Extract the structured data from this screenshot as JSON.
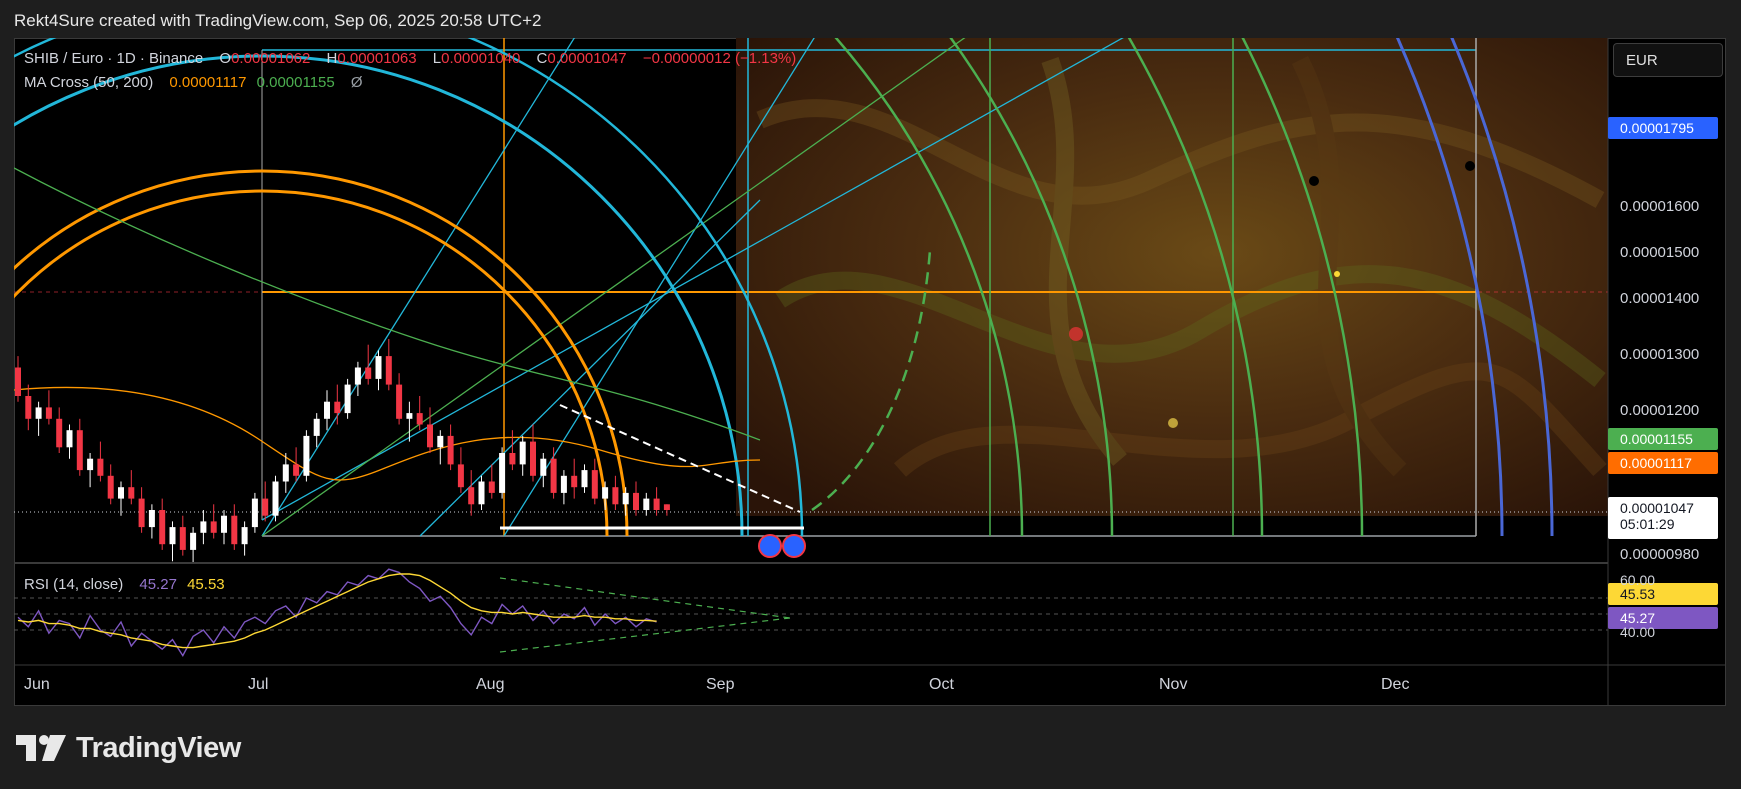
{
  "header": {
    "attribution": "Rekt4Sure created with TradingView.com, Sep 06, 2025 20:58 UTC+2"
  },
  "legend": {
    "symbol": "SHIB / Euro · 1D · Binance",
    "o_label": "O",
    "o_value": "0.00001062",
    "h_label": "H",
    "h_value": "0.00001063",
    "l_label": "L",
    "l_value": "0.00001040",
    "c_label": "C",
    "c_value": "0.00001047",
    "change": "−0.00000012 (−1.13%)",
    "ma_label": "MA Cross (50, 200)",
    "ma_fast": "0.00001117",
    "ma_slow": "0.00001155",
    "ma_extra": "Ø",
    "rsi_label": "RSI (14, close)",
    "rsi_value": "45.27",
    "rsi_ma": "45.53"
  },
  "currency_button": "EUR",
  "colors": {
    "up": "#ffffff",
    "down": "#f23645",
    "ma_fast": "#ff9800",
    "ma_slow": "#4caf50",
    "rsi": "#7e57c2",
    "rsi_ma": "#fdd835",
    "fib_cyan": "#22b7d9",
    "fib_green": "#4caf50",
    "fib_blue": "#4a67d6",
    "fib_orange": "#ff9800",
    "accent": "#2962ff"
  },
  "price_tags": {
    "top": "0.00001795",
    "ma_slow": "0.00001155",
    "ma_fast": "0.00001117",
    "last": "0.00001047",
    "countdown": "05:01:29",
    "rsi_ma": "45.53",
    "rsi": "45.27"
  },
  "logo": {
    "text": "TradingView"
  },
  "chart_data": [
    {
      "type": "candlestick",
      "title": "SHIB / Euro · 1D · Binance",
      "y_ticks": [
        "0.00001600",
        "0.00001500",
        "0.00001400",
        "0.00001300",
        "0.00001200",
        "0.00000980"
      ],
      "x_ticks": [
        "Jun",
        "Jul",
        "Aug",
        "Sep",
        "Oct",
        "Nov",
        "Dec"
      ],
      "last_close": 1.047e-05,
      "highlight_levels": [
        1.795e-05,
        1.155e-05,
        1.117e-05,
        1.047e-05,
        1.42e-05
      ],
      "ylim": [
        9.4e-06,
        1.85e-05
      ],
      "ohlc_approx": [
        [
          1.3e-05,
          1.32e-05,
          1.24e-05,
          1.25e-05
        ],
        [
          1.25e-05,
          1.27e-05,
          1.19e-05,
          1.21e-05
        ],
        [
          1.21e-05,
          1.24e-05,
          1.18e-05,
          1.23e-05
        ],
        [
          1.23e-05,
          1.26e-05,
          1.2e-05,
          1.21e-05
        ],
        [
          1.21e-05,
          1.23e-05,
          1.15e-05,
          1.16e-05
        ],
        [
          1.16e-05,
          1.2e-05,
          1.14e-05,
          1.19e-05
        ],
        [
          1.19e-05,
          1.21e-05,
          1.11e-05,
          1.12e-05
        ],
        [
          1.12e-05,
          1.15e-05,
          1.09e-05,
          1.14e-05
        ],
        [
          1.14e-05,
          1.17e-05,
          1.1e-05,
          1.11e-05
        ],
        [
          1.11e-05,
          1.13e-05,
          1.06e-05,
          1.07e-05
        ],
        [
          1.07e-05,
          1.1e-05,
          1.04e-05,
          1.09e-05
        ],
        [
          1.09e-05,
          1.12e-05,
          1.06e-05,
          1.07e-05
        ],
        [
          1.07e-05,
          1.09e-05,
          1.01e-05,
          1.02e-05
        ],
        [
          1.02e-05,
          1.06e-05,
          1e-05,
          1.05e-05
        ],
        [
          1.05e-05,
          1.07e-05,
          9.8e-06,
          9.9e-06
        ],
        [
          9.9e-06,
          1.03e-05,
          9.6e-06,
          1.02e-05
        ],
        [
          1.02e-05,
          1.04e-05,
          9.7e-06,
          9.8e-06
        ],
        [
          9.8e-06,
          1.02e-05,
          9.5e-06,
          1.01e-05
        ],
        [
          1.01e-05,
          1.05e-05,
          9.9e-06,
          1.03e-05
        ],
        [
          1.03e-05,
          1.06e-05,
          1e-05,
          1.01e-05
        ],
        [
          1.01e-05,
          1.05e-05,
          9.9e-06,
          1.04e-05
        ],
        [
          1.04e-05,
          1.06e-05,
          9.8e-06,
          9.9e-06
        ],
        [
          9.9e-06,
          1.03e-05,
          9.7e-06,
          1.02e-05
        ],
        [
          1.02e-05,
          1.08e-05,
          1.01e-05,
          1.07e-05
        ],
        [
          1.07e-05,
          1.1e-05,
          1.03e-05,
          1.04e-05
        ],
        [
          1.04e-05,
          1.11e-05,
          1.03e-05,
          1.1e-05
        ],
        [
          1.1e-05,
          1.15e-05,
          1.08e-05,
          1.13e-05
        ],
        [
          1.13e-05,
          1.16e-05,
          1.1e-05,
          1.11e-05
        ],
        [
          1.11e-05,
          1.19e-05,
          1.1e-05,
          1.18e-05
        ],
        [
          1.18e-05,
          1.22e-05,
          1.16e-05,
          1.21e-05
        ],
        [
          1.21e-05,
          1.26e-05,
          1.19e-05,
          1.24e-05
        ],
        [
          1.24e-05,
          1.27e-05,
          1.2e-05,
          1.22e-05
        ],
        [
          1.22e-05,
          1.28e-05,
          1.21e-05,
          1.27e-05
        ],
        [
          1.27e-05,
          1.31e-05,
          1.25e-05,
          1.3e-05
        ],
        [
          1.3e-05,
          1.34e-05,
          1.27e-05,
          1.28e-05
        ],
        [
          1.28e-05,
          1.33e-05,
          1.26e-05,
          1.32e-05
        ],
        [
          1.32e-05,
          1.35e-05,
          1.26e-05,
          1.27e-05
        ],
        [
          1.27e-05,
          1.29e-05,
          1.2e-05,
          1.21e-05
        ],
        [
          1.21e-05,
          1.24e-05,
          1.17e-05,
          1.22e-05
        ],
        [
          1.22e-05,
          1.25e-05,
          1.19e-05,
          1.2e-05
        ],
        [
          1.2e-05,
          1.23e-05,
          1.15e-05,
          1.16e-05
        ],
        [
          1.16e-05,
          1.19e-05,
          1.13e-05,
          1.18e-05
        ],
        [
          1.18e-05,
          1.2e-05,
          1.12e-05,
          1.13e-05
        ],
        [
          1.13e-05,
          1.16e-05,
          1.08e-05,
          1.09e-05
        ],
        [
          1.09e-05,
          1.12e-05,
          1.04e-05,
          1.06e-05
        ],
        [
          1.06e-05,
          1.11e-05,
          1.05e-05,
          1.1e-05
        ],
        [
          1.1e-05,
          1.13e-05,
          1.07e-05,
          1.08e-05
        ],
        [
          1.08e-05,
          1.16e-05,
          1.07e-05,
          1.15e-05
        ],
        [
          1.15e-05,
          1.19e-05,
          1.12e-05,
          1.13e-05
        ],
        [
          1.13e-05,
          1.18e-05,
          1.11e-05,
          1.17e-05
        ],
        [
          1.17e-05,
          1.2e-05,
          1.1e-05,
          1.11e-05
        ],
        [
          1.11e-05,
          1.15e-05,
          1.09e-05,
          1.14e-05
        ],
        [
          1.14e-05,
          1.16e-05,
          1.07e-05,
          1.08e-05
        ],
        [
          1.08e-05,
          1.12e-05,
          1.06e-05,
          1.11e-05
        ],
        [
          1.11e-05,
          1.14e-05,
          1.07e-05,
          1.09e-05
        ],
        [
          1.09e-05,
          1.13e-05,
          1.08e-05,
          1.12e-05
        ],
        [
          1.12e-05,
          1.14e-05,
          1.06e-05,
          1.07e-05
        ],
        [
          1.07e-05,
          1.1e-05,
          1.05e-05,
          1.09e-05
        ],
        [
          1.09e-05,
          1.11e-05,
          1.05e-05,
          1.06e-05
        ],
        [
          1.06e-05,
          1.09e-05,
          1.04e-05,
          1.08e-05
        ],
        [
          1.08e-05,
          1.1e-05,
          1.04e-05,
          1.05e-05
        ],
        [
          1.05e-05,
          1.08e-05,
          1.04e-05,
          1.07e-05
        ],
        [
          1.07e-05,
          1.09e-05,
          1.04e-05,
          1.05e-05
        ],
        [
          1.06e-05,
          1.06e-05,
          1.04e-05,
          1.05e-05
        ]
      ]
    },
    {
      "type": "line",
      "title": "RSI (14, close)",
      "y_ticks": [
        "60.00",
        "40.00"
      ],
      "ylim": [
        20,
        80
      ],
      "series": [
        {
          "name": "RSI",
          "values": [
            48,
            42,
            52,
            38,
            46,
            44,
            35,
            49,
            40,
            36,
            45,
            30,
            38,
            33,
            28,
            34,
            24,
            36,
            40,
            32,
            42,
            35,
            45,
            48,
            44,
            52,
            55,
            48,
            60,
            57,
            64,
            62,
            70,
            68,
            74,
            72,
            78,
            76,
            70,
            66,
            58,
            61,
            54,
            44,
            37,
            48,
            44,
            56,
            50,
            55,
            46,
            52,
            44,
            50,
            47,
            54,
            43,
            50,
            44,
            48,
            42,
            47,
            45
          ],
          "color": "#7e57c2"
        },
        {
          "name": "RSI MA",
          "values": [
            46,
            45,
            46,
            44,
            44,
            43,
            41,
            41,
            39,
            38,
            37,
            35,
            34,
            33,
            31,
            30,
            29,
            29,
            30,
            31,
            32,
            33,
            35,
            38,
            40,
            43,
            46,
            49,
            52,
            55,
            58,
            61,
            64,
            67,
            70,
            72,
            74,
            75,
            75,
            74,
            71,
            67,
            63,
            58,
            54,
            52,
            51,
            51,
            50,
            51,
            50,
            49,
            48,
            48,
            48,
            49,
            48,
            48,
            47,
            47,
            46,
            46,
            45.5
          ],
          "color": "#fdd835"
        }
      ]
    }
  ]
}
